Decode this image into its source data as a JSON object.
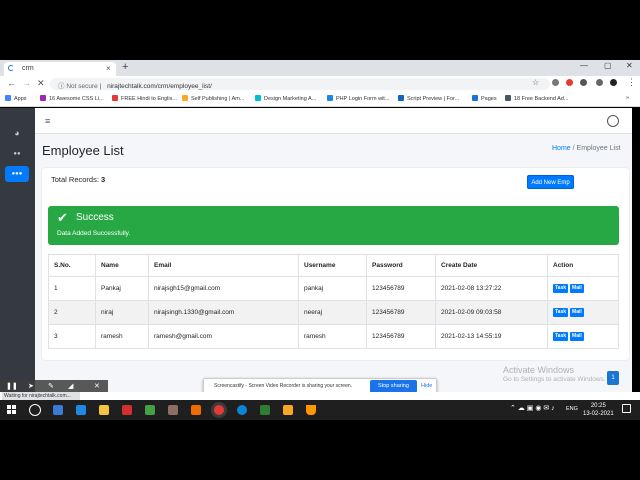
{
  "browser": {
    "tab_title": "crm",
    "tab_close": "×",
    "new_tab": "+",
    "window_controls": [
      "—",
      "▢",
      "✕"
    ],
    "nav": {
      "back": "←",
      "forward": "→",
      "reload": "✕"
    },
    "security": "Not secure",
    "url": "nirajtechtalk.com/crm/employee_list/",
    "bookmarks": [
      {
        "label": "Apps",
        "color": "#4285f4"
      },
      {
        "label": "16 Awesome CSS Li...",
        "color": "#9c27b0"
      },
      {
        "label": "FREE Hindi to Englis...",
        "color": "#e53935"
      },
      {
        "label": "Self Publishing | Am...",
        "color": "#f9a825"
      },
      {
        "label": "Design Marketing A...",
        "color": "#00bcd4"
      },
      {
        "label": "PHP Login Form wit...",
        "color": "#1e88e5"
      },
      {
        "label": "Script Preview | For...",
        "color": "#1565c0"
      },
      {
        "label": "Pages",
        "color": "#1976d2"
      },
      {
        "label": "18 Free Backend Ad...",
        "color": "#455a64"
      }
    ]
  },
  "sidebar": {
    "items": [
      {
        "name": "dashboard-icon",
        "glyph": "◕"
      },
      {
        "name": "users-icon",
        "glyph": "●●"
      },
      {
        "name": "employees-icon",
        "glyph": "●●●",
        "active": true
      }
    ]
  },
  "header": {
    "menu_icon": "≡"
  },
  "page": {
    "title": "Employee List",
    "breadcrumb_home": "Home",
    "breadcrumb_sep": "/",
    "breadcrumb_current": "Employee List",
    "total_label": "Total Records:",
    "total_count": "3",
    "add_button": "Add New Emp"
  },
  "alert": {
    "icon": "✔",
    "title": "Success",
    "message": "Data Added Successfully.",
    "color": "#28a745"
  },
  "table": {
    "headers": [
      "S.No.",
      "Name",
      "Email",
      "Username",
      "Password",
      "Create Date",
      "Action"
    ],
    "rows": [
      [
        "1",
        "Pankaj",
        "nirajsgh15@gmail.com",
        "pankaj",
        "123456789",
        "2021-02-08 13:27:22"
      ],
      [
        "2",
        "niraj",
        "nirajsingh.1330@gmail.com",
        "neeraj",
        "123456789",
        "2021-02-09 09:03:58"
      ],
      [
        "3",
        "ramesh",
        "ramesh@gmail.com",
        "ramesh",
        "123456789",
        "2021-02-13 14:55:19"
      ]
    ],
    "action_task": "Task",
    "action_mail": "Mail"
  },
  "windows": {
    "activate_title": "Activate Windows",
    "activate_sub": "Go to Settings to activate Windows.",
    "scroll_badge": "1"
  },
  "share_bar": {
    "text": "Screencastify - Screen Video Recorder is sharing your screen.",
    "stop": "Stop sharing",
    "hide": "Hide"
  },
  "status": {
    "text": "Waiting for nirajtechtalk.com..."
  },
  "taskbar": {
    "tray": "ENG",
    "time": "20:25",
    "date": "13-02-2021"
  }
}
